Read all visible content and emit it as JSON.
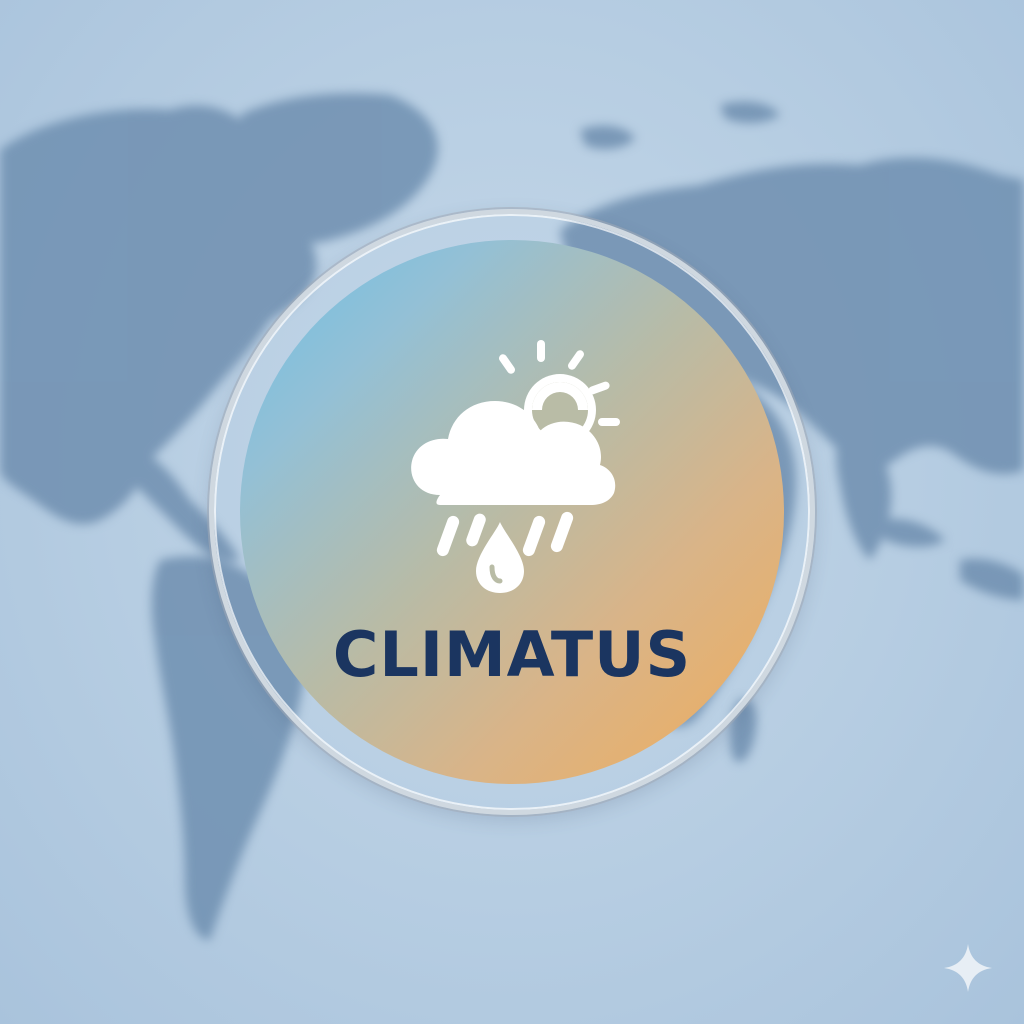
{
  "brand": {
    "name": "CLIMATUS"
  },
  "icons": {
    "logo": "cloud-sun-rain-icon",
    "corner": "sparkle-icon"
  },
  "colors": {
    "background": "#b9cfe2",
    "continents": "#6f8fb0",
    "gradient_start": "#6ec0e3",
    "gradient_end": "#f0ad5a",
    "brand_text": "#1b3560",
    "ring": "#cfd8e0"
  }
}
